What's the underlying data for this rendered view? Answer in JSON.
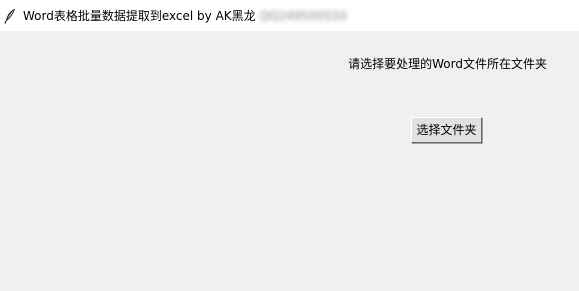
{
  "window": {
    "title": "Word表格批量数据提取到excel by AK黑龙 ",
    "title_obscured": "QQ249500550",
    "icon": "feather-icon"
  },
  "main": {
    "prompt_label": "请选择要处理的Word文件所在文件夹",
    "choose_folder_button": "选择文件夹"
  },
  "colors": {
    "window_bg": "#f0f0f0",
    "titlebar_bg": "#ffffff",
    "button_bg": "#e1e1e1"
  }
}
